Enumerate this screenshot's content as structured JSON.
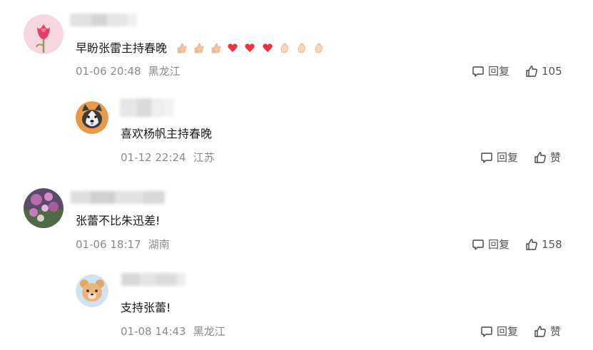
{
  "comments": [
    {
      "content": "早盼张雷主持春晚",
      "emojis": [
        "thumbs-up",
        "thumbs-up",
        "thumbs-up",
        "heart",
        "heart",
        "heart",
        "clap",
        "clap",
        "clap"
      ],
      "date": "01-06 20:48",
      "location": "黑龙江",
      "reply_label": "回复",
      "like_count": "105",
      "avatar": "tulip-avatar",
      "reply": {
        "content": "喜欢杨帆主持春晚",
        "date": "01-12 22:24",
        "location": "江苏",
        "reply_label": "回复",
        "like_label": "赞",
        "avatar": "husky-dog-avatar"
      }
    },
    {
      "content": "张蕾不比朱迅差!",
      "date": "01-06 18:17",
      "location": "湖南",
      "reply_label": "回复",
      "like_count": "158",
      "avatar": "flowers-avatar",
      "reply": {
        "content": "支持张蕾!",
        "date": "01-08 14:43",
        "location": "黑龙江",
        "reply_label": "回复",
        "like_label": "赞",
        "avatar": "bear-cartoon-avatar"
      }
    }
  ],
  "colors": {
    "meta": "#8a8a8a",
    "heart": "#e8343a",
    "hand": "#f6c49a"
  }
}
